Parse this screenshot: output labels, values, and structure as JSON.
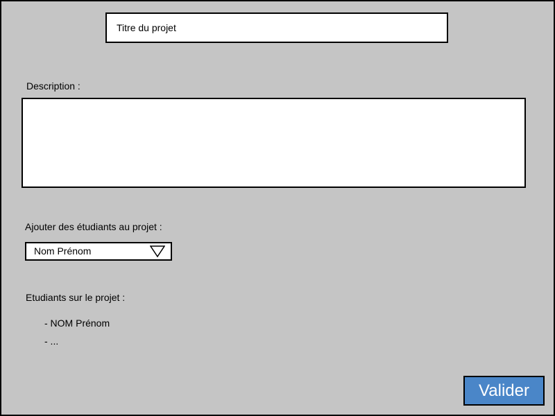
{
  "form": {
    "title_field": {
      "placeholder": "Titre du projet"
    },
    "description": {
      "label": "Description :",
      "value": ""
    },
    "add_students": {
      "label": "Ajouter des étudiants au projet :",
      "selected": "Nom Prénom",
      "arrow_icon": "triangle-down-icon"
    },
    "students_on_project": {
      "label": "Etudiants sur le projet :",
      "items": [
        "- NOM Prénom",
        "- ..."
      ]
    },
    "submit": {
      "label": "Valider",
      "color": "#4a86c8"
    }
  },
  "colors": {
    "background": "#c5c5c5",
    "field_background": "#ffffff",
    "border": "#000000"
  }
}
